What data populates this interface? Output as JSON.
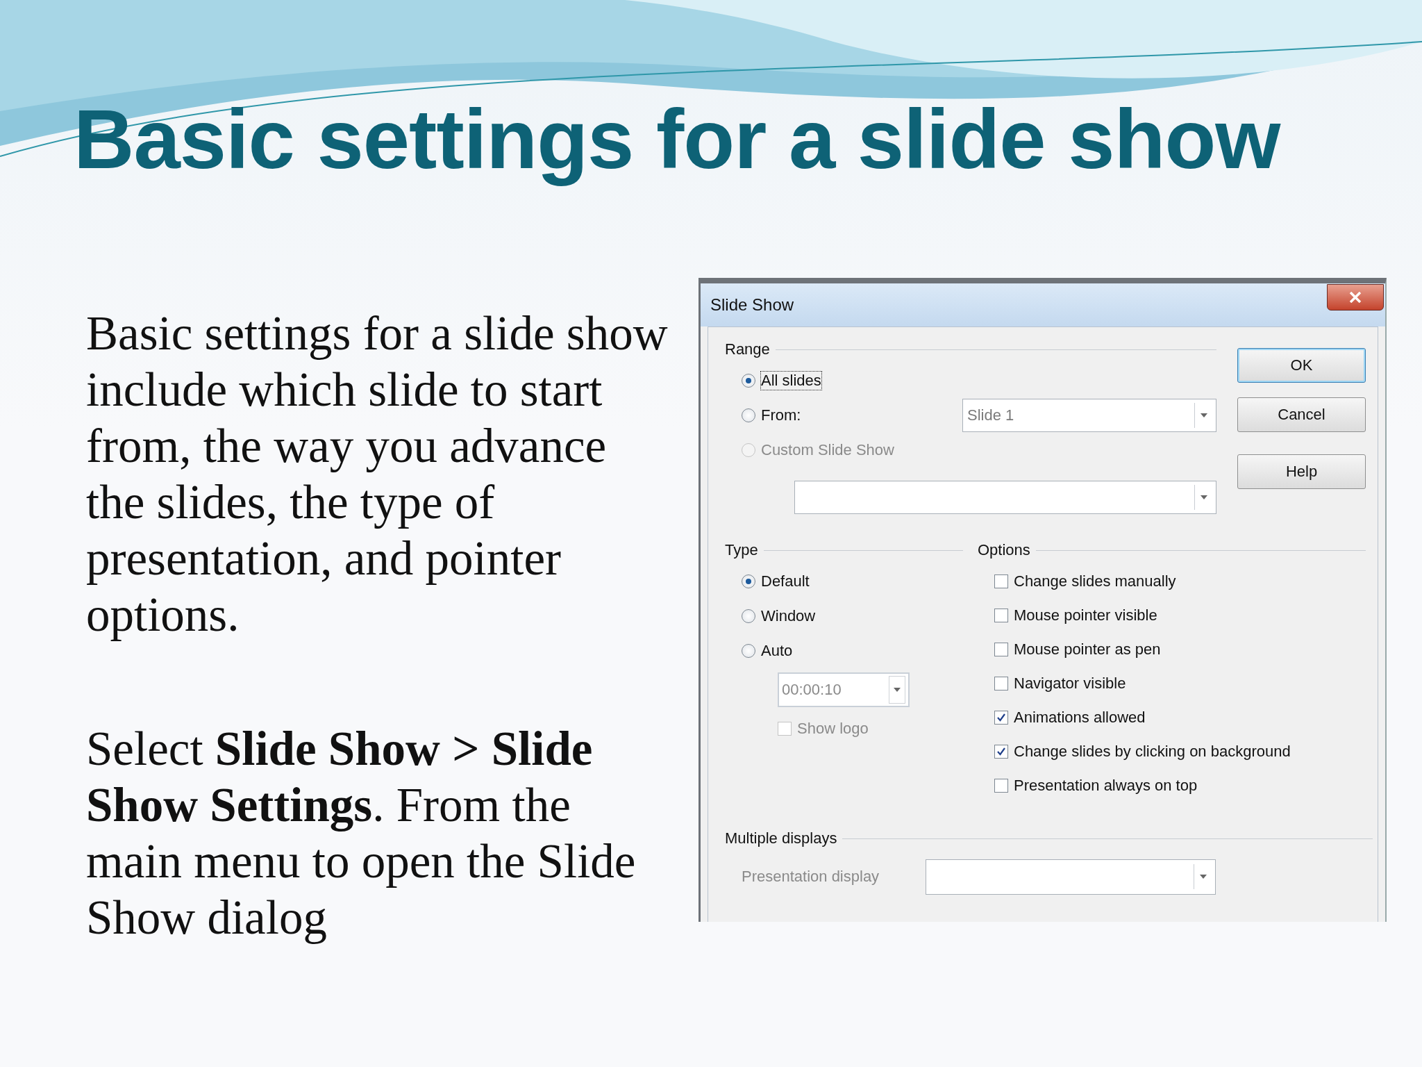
{
  "slide": {
    "title": "Basic settings for a slide show",
    "paragraphs": [
      "Basic settings for a slide show include which slide to start from, the way you advance the slides, the type of presentation, and pointer options.",
      "Select **Slide Show > Slide Show Settings**. From the main menu to open the Slide Show dialog"
    ]
  },
  "dialog": {
    "title": "Slide Show",
    "range": {
      "label": "Range",
      "options": [
        {
          "label": "All slides",
          "selected": true,
          "disabled": false,
          "focused": true
        },
        {
          "label": "From:",
          "selected": false,
          "disabled": false,
          "focused": false
        },
        {
          "label": "Custom Slide Show",
          "selected": false,
          "disabled": true,
          "focused": false
        }
      ],
      "from_value": "Slide 1"
    },
    "buttons": [
      {
        "label": "OK",
        "default": true
      },
      {
        "label": "Cancel",
        "default": false
      },
      {
        "label": "Help",
        "default": false
      }
    ],
    "type": {
      "label": "Type",
      "options": [
        {
          "label": "Default",
          "selected": true
        },
        {
          "label": "Window",
          "selected": false
        },
        {
          "label": "Auto",
          "selected": false
        }
      ],
      "pause": {
        "value": "00:00:10",
        "disabled": true
      },
      "show_logo": {
        "label": "Show logo",
        "checked": false,
        "disabled": true
      }
    },
    "options": {
      "label": "Options",
      "items": [
        {
          "label": "Change slides manually",
          "checked": false
        },
        {
          "label": "Mouse pointer visible",
          "checked": false
        },
        {
          "label": "Mouse pointer as pen",
          "checked": false
        },
        {
          "label": "Navigator visible",
          "checked": false
        },
        {
          "label": "Animations allowed",
          "checked": true
        },
        {
          "label": "Change slides by clicking on background",
          "checked": true
        },
        {
          "label": "Presentation always on top",
          "checked": false
        }
      ]
    },
    "displays": {
      "label": "Multiple displays",
      "field_label": "Presentation display",
      "disabled": true
    }
  }
}
